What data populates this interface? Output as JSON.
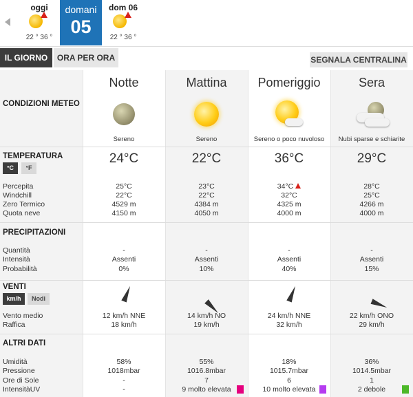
{
  "days": {
    "today": {
      "label": "oggi",
      "temps": "22 ° 36 °"
    },
    "selected": {
      "label": "domani",
      "number": "05"
    },
    "next": {
      "label": "dom 06",
      "temps": "22 ° 36 °"
    }
  },
  "tabs": {
    "giorno": "IL GIORNO",
    "ora": "ORA PER ORA",
    "segnala": "SEGNALA CENTRALINA"
  },
  "labels": {
    "conditions": "CONDIZIONI METEO",
    "temperature": "TEMPERATURA",
    "celsius": "°C",
    "fahrenheit": "°F",
    "perceived": "Percepita",
    "windchill": "Windchill",
    "zero_termico": "Zero Termico",
    "quota_neve": "Quota neve",
    "precipitation": "PRECIPITAZIONI",
    "quantity": "Quantità",
    "intensity": "Intensità",
    "probability": "Probabilità",
    "wind": "VENTI",
    "kmh": "km/h",
    "knots": "Nodi",
    "wind_avg": "Vento medio",
    "gust": "Raffica",
    "other": "ALTRI DATI",
    "humidity": "Umidità",
    "pressure": "Pressione",
    "sun_hours": "Ore di Sole",
    "uv": "IntensitàUV"
  },
  "periods": [
    {
      "name": "Notte",
      "icon": "moon-icon",
      "condition": "Sereno",
      "temp": "24°C",
      "perceived": "25°C",
      "perceived_warning": false,
      "windchill": "22°C",
      "zero_termico": "4529 m",
      "quota_neve": "4150 m",
      "quantity": "-",
      "intensity": "Assenti",
      "probability": "0%",
      "wind_avg": "12 km/h  NNE",
      "gust": "18 km/h",
      "wind_deg": 22,
      "humidity": "58%",
      "pressure": "1018mbar",
      "sun_hours": "-",
      "uv": "-",
      "uv_color": ""
    },
    {
      "name": "Mattina",
      "icon": "sun-icon",
      "condition": "Sereno",
      "temp": "22°C",
      "perceived": "23°C",
      "perceived_warning": false,
      "windchill": "22°C",
      "zero_termico": "4384 m",
      "quota_neve": "4050 m",
      "quantity": "-",
      "intensity": "Assenti",
      "probability": "10%",
      "wind_avg": "14 km/h NO",
      "gust": "19 km/h",
      "wind_deg": 135,
      "humidity": "55%",
      "pressure": "1016.8mbar",
      "sun_hours": "7",
      "uv": "9 molto elevata",
      "uv_color": "#e5007e"
    },
    {
      "name": "Pomeriggio",
      "icon": "sun-cloud-icon",
      "condition": "Sereno o poco nuvoloso",
      "temp": "36°C",
      "perceived": "34°C",
      "perceived_warning": true,
      "windchill": "32°C",
      "zero_termico": "4325 m",
      "quota_neve": "4000 m",
      "quantity": "-",
      "intensity": "Assenti",
      "probability": "40%",
      "wind_avg": "24 km/h NNE",
      "gust": "32 km/h",
      "wind_deg": 22,
      "humidity": "18%",
      "pressure": "1015.7mbar",
      "sun_hours": "6",
      "uv": "10 molto elevata",
      "uv_color": "#b53cf0"
    },
    {
      "name": "Sera",
      "icon": "cloudy-icon",
      "condition": "Nubi sparse e schiarite",
      "temp": "29°C",
      "perceived": "28°C",
      "perceived_warning": false,
      "windchill": "25°C",
      "zero_termico": "4266 m",
      "quota_neve": "4000 m",
      "quantity": "-",
      "intensity": "Assenti",
      "probability": "15%",
      "wind_avg": "22 km/h ONO",
      "gust": "29 km/h",
      "wind_deg": 112,
      "humidity": "36%",
      "pressure": "1014.5mbar",
      "sun_hours": "1",
      "uv": "2 debole",
      "uv_color": "#4cb828"
    }
  ]
}
